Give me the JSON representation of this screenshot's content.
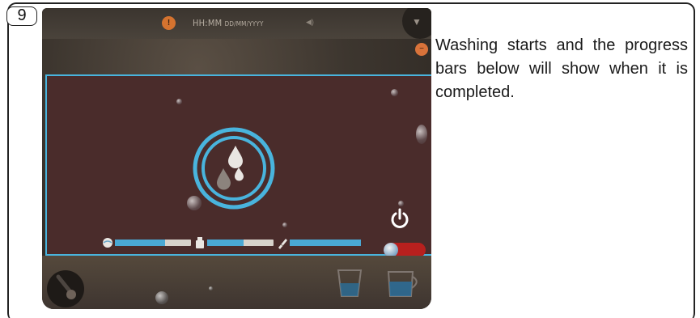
{
  "step": {
    "number": "9"
  },
  "status_bar": {
    "time_format": "HH:MM",
    "date_format": "DD/MM/YYYY",
    "warning_icon": "warning-icon",
    "sound_icon": "speaker-icon",
    "menu_icon": "chevron-down-icon"
  },
  "panel": {
    "border_color": "#49b4dd",
    "background_color": "#4a2c2b",
    "status_icon": "washing-drops-icon",
    "power_icon": "power-icon"
  },
  "progress": {
    "accent_color": "#4aa8d4",
    "bars": [
      {
        "icon": "rinse-icon",
        "fill_fraction": 0.66
      },
      {
        "icon": "detergent-bottle-icon",
        "fill_fraction": 0.55
      },
      {
        "icon": "brush-icon",
        "fill_fraction": 1.0
      }
    ],
    "toggle": {
      "state": "off",
      "color": "#b8201e"
    }
  },
  "description": {
    "text": "Washing starts and the progress bars below will show when it is completed."
  }
}
